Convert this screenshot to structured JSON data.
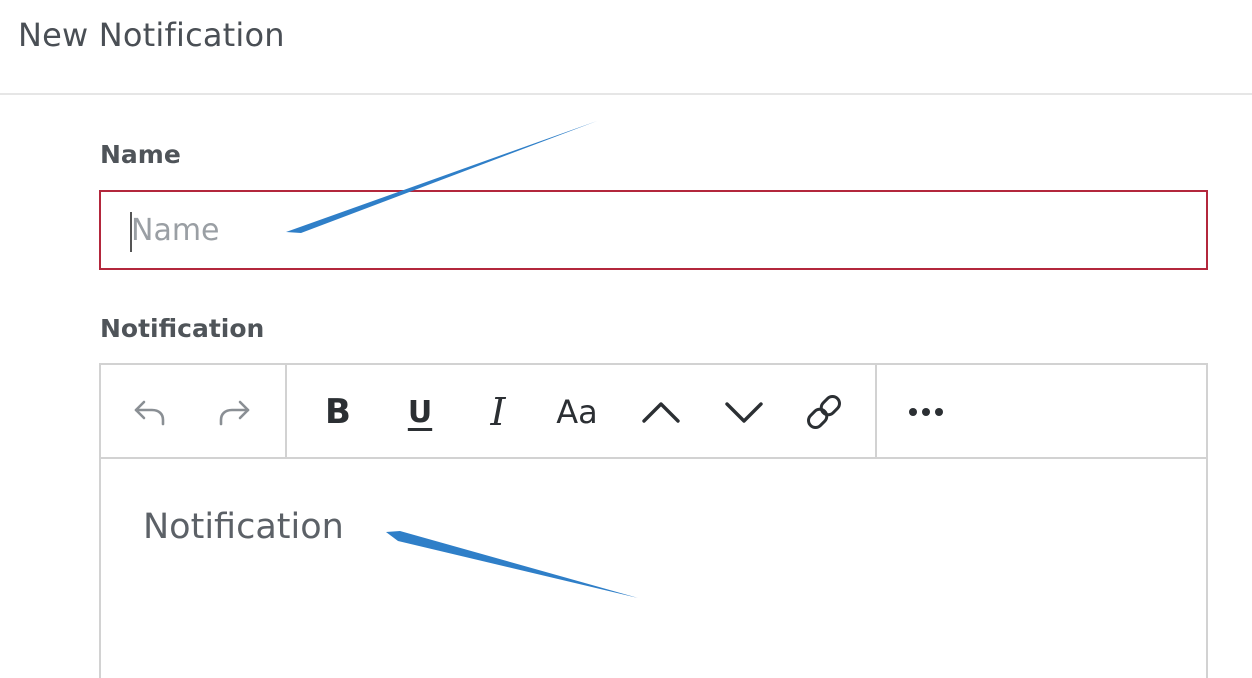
{
  "header": {
    "title": "New Notification"
  },
  "form": {
    "name_label": "Name",
    "name_placeholder": "Name",
    "notification_label": "Notification",
    "editor_placeholder": "Notification"
  },
  "toolbar": {
    "undo": "undo-icon",
    "redo": "redo-icon",
    "bold": "B",
    "underline": "U",
    "italic": "I",
    "font_size": "Aa",
    "move_up": "chevron-up-icon",
    "move_down": "chevron-down-icon",
    "link": "link-icon",
    "more": "more-icon"
  },
  "colors": {
    "error_border": "#b3273c",
    "annotation_arrow": "#2f7fc8"
  }
}
